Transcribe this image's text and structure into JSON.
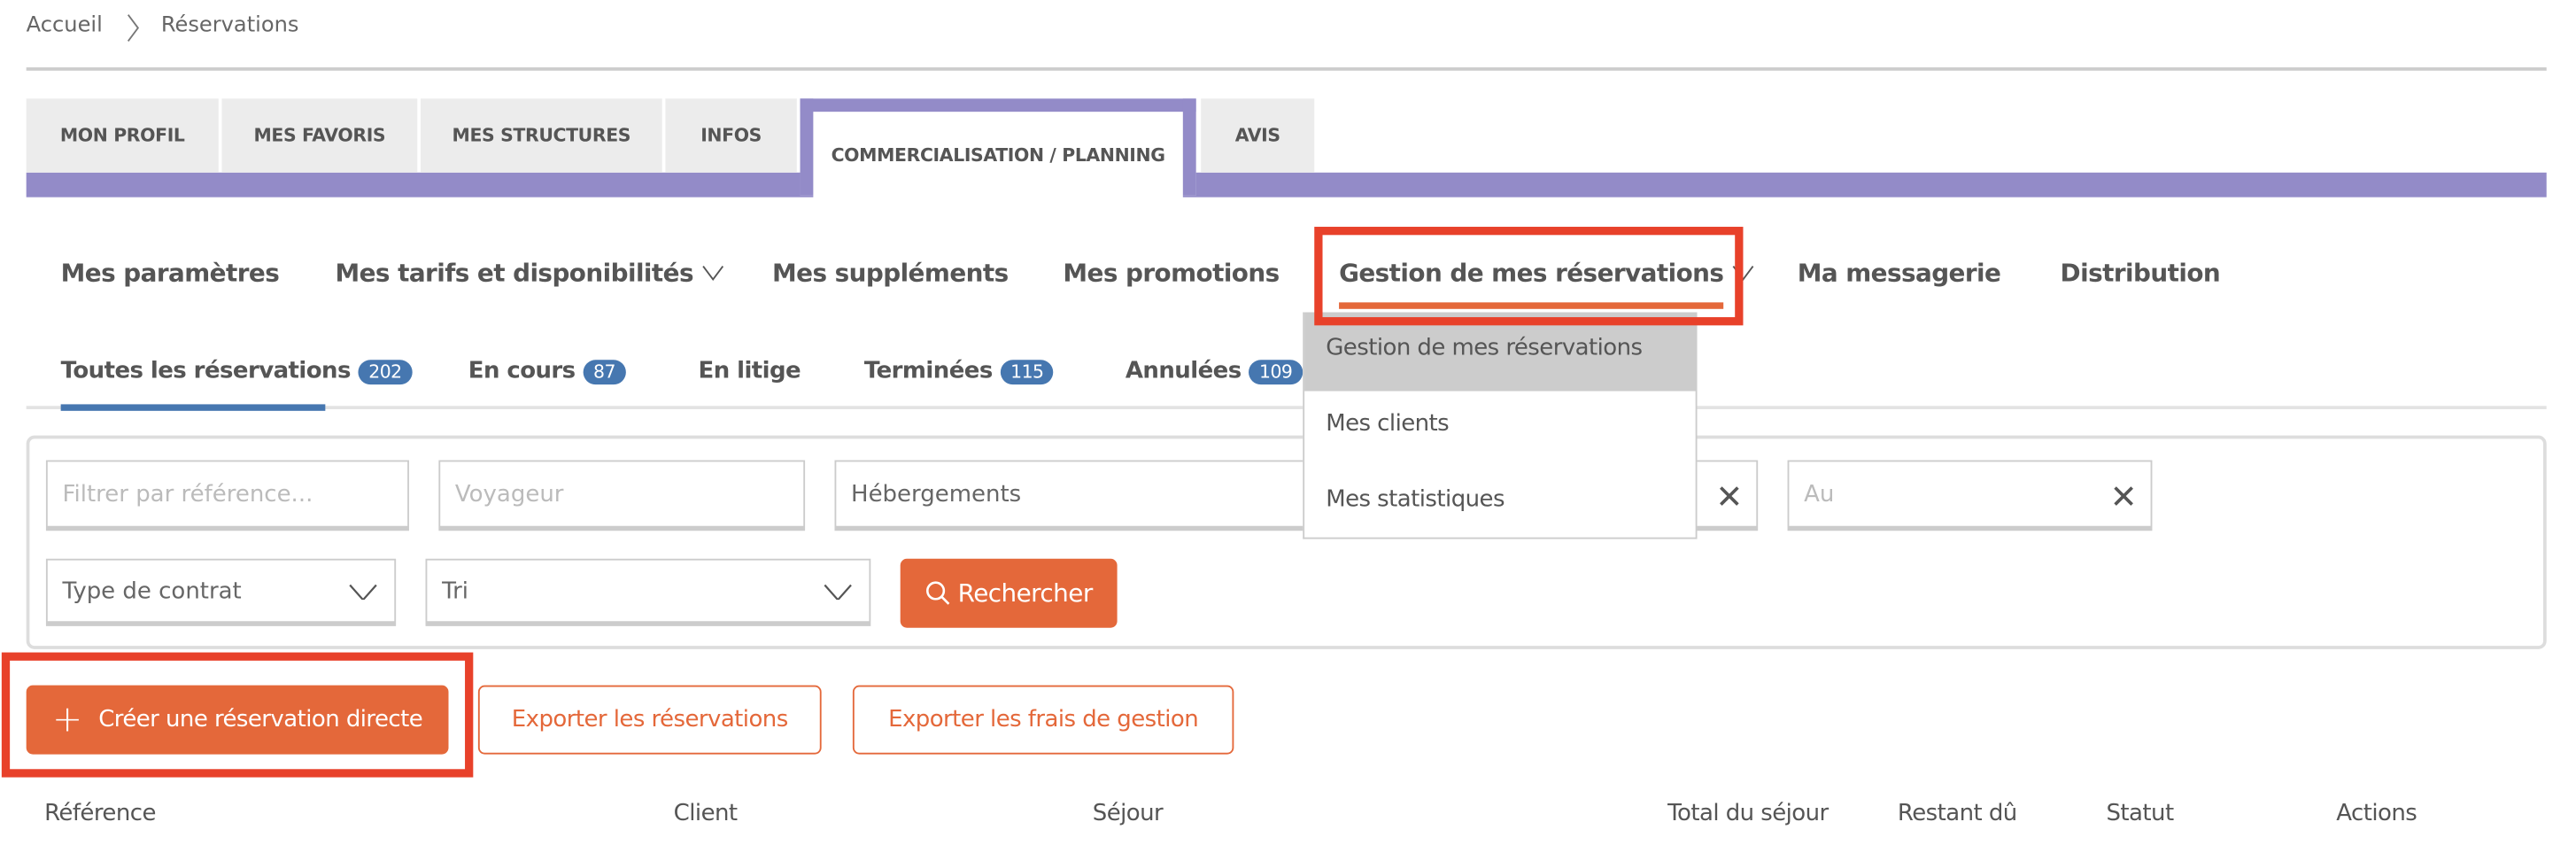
{
  "breadcrumb": {
    "home": "Accueil",
    "current": "Réservations"
  },
  "tabs": [
    {
      "label": "MON PROFIL"
    },
    {
      "label": "MES FAVORIS"
    },
    {
      "label": "MES STRUCTURES"
    },
    {
      "label": "INFOS"
    },
    {
      "label": "COMMERCIALISATION / PLANNING",
      "active": true
    },
    {
      "label": "AVIS"
    }
  ],
  "submenu": [
    {
      "label": "Mes paramètres"
    },
    {
      "label": "Mes tarifs et disponibilités"
    },
    {
      "label": "Mes suppléments"
    },
    {
      "label": "Mes promotions"
    },
    {
      "label": "Gestion de mes réservations",
      "active": true
    },
    {
      "label": "Ma messagerie"
    },
    {
      "label": "Distribution"
    }
  ],
  "dropdown": {
    "items": [
      "Gestion de mes réservations",
      "Mes clients",
      "Mes statistiques"
    ],
    "highlighted": 0
  },
  "status_tabs": [
    {
      "label": "Toutes les réservations",
      "count": "202",
      "active": true
    },
    {
      "label": "En cours",
      "count": "87"
    },
    {
      "label": "En litige"
    },
    {
      "label": "Terminées",
      "count": "115"
    },
    {
      "label": "Annulées",
      "count": "109"
    }
  ],
  "filters": {
    "reference_placeholder": "Filtrer par référence...",
    "traveler_placeholder": "Voyageur",
    "accommodations": "Hébergements",
    "to_placeholder": "Au",
    "contract_type": "Type de contrat",
    "sort": "Tri",
    "search_button": "Rechercher"
  },
  "actions": {
    "create": "Créer une réservation directe",
    "export_reservations": "Exporter les réservations",
    "export_fees": "Exporter les frais de gestion"
  },
  "table": {
    "columns": [
      "Référence",
      "Client",
      "Séjour",
      "Total du séjour",
      "Restant dû",
      "Statut",
      "Actions"
    ]
  },
  "colors": {
    "accent": "#e4683a",
    "purple": "#938bc8",
    "badge": "#4677b0",
    "highlight": "#e8412a"
  }
}
